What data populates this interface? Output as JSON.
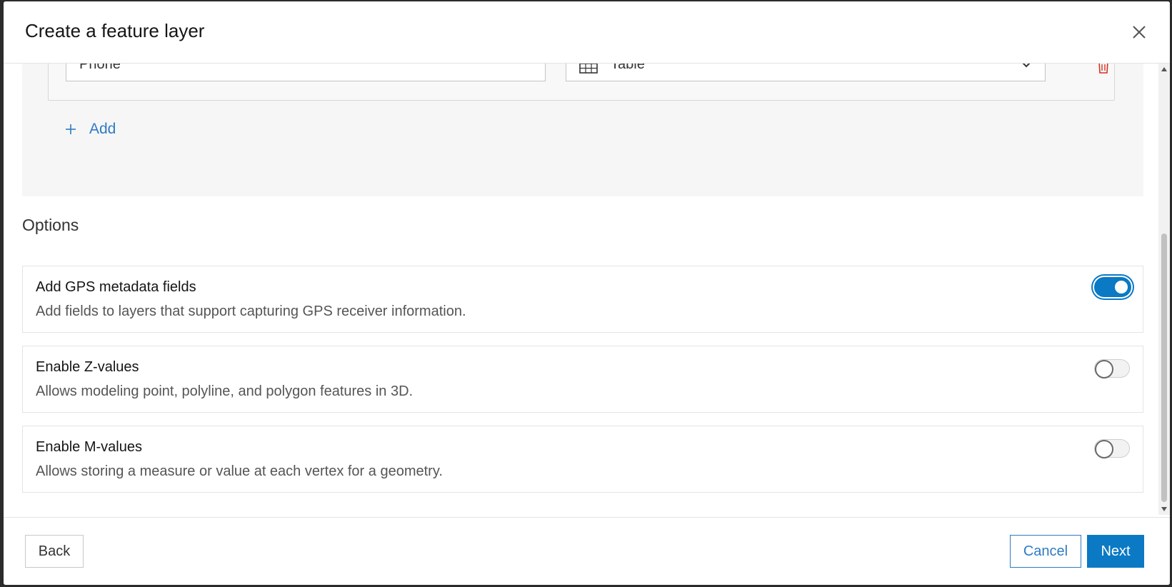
{
  "dialog": {
    "title": "Create a feature layer",
    "close_icon": "close-icon"
  },
  "field_row": {
    "name_value": "Phone",
    "type_value": "Table",
    "type_icon": "table-icon",
    "dropdown_icon": "chevron-down-icon",
    "delete_icon": "trash-icon"
  },
  "add": {
    "label": "Add",
    "icon": "plus-icon"
  },
  "options": {
    "title": "Options",
    "items": [
      {
        "title": "Add GPS metadata fields",
        "description": "Add fields to layers that support capturing GPS receiver information.",
        "enabled": true
      },
      {
        "title": "Enable Z-values",
        "description": "Allows modeling point, polyline, and polygon features in 3D.",
        "enabled": false
      },
      {
        "title": "Enable M-values",
        "description": "Allows storing a measure or value at each vertex for a geometry.",
        "enabled": false
      }
    ]
  },
  "footer": {
    "back_label": "Back",
    "cancel_label": "Cancel",
    "next_label": "Next"
  },
  "colors": {
    "accent": "#0b79c3",
    "link": "#2f7bc2",
    "danger": "#d83020"
  }
}
